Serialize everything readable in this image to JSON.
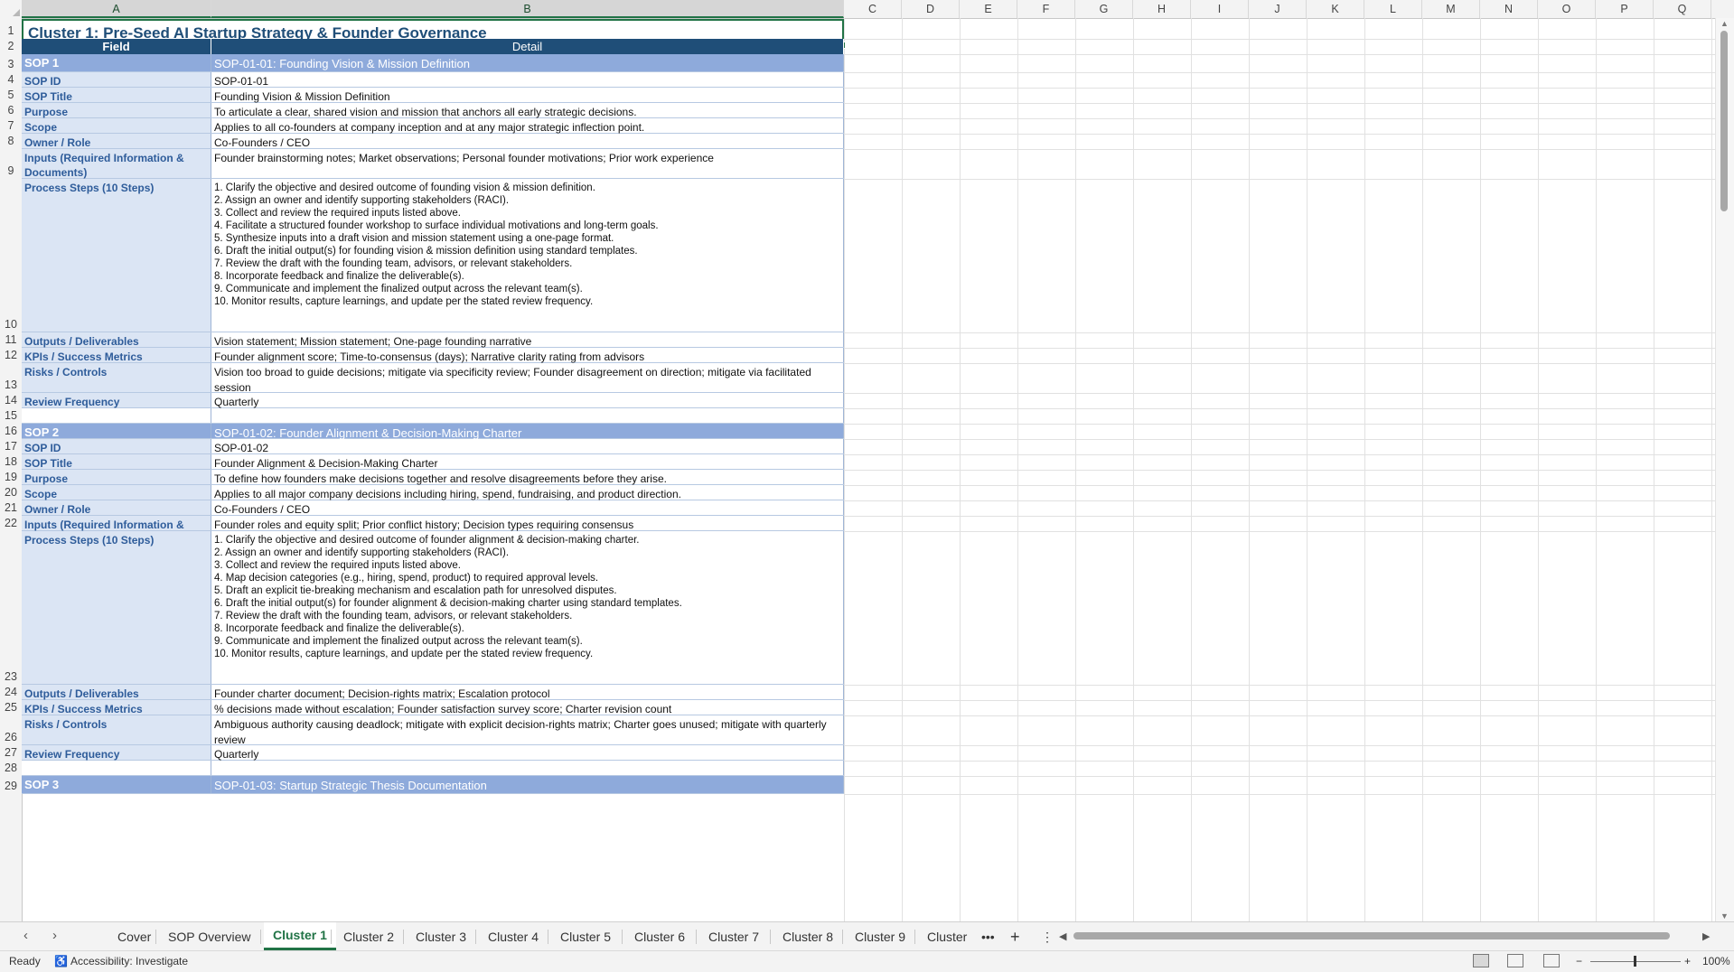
{
  "columns": [
    "A",
    "B",
    "C",
    "D",
    "E",
    "F",
    "G",
    "H",
    "I",
    "J",
    "K",
    "L",
    "M",
    "N",
    "O",
    "P",
    "Q"
  ],
  "title": "Cluster 1: Pre-Seed AI Startup Strategy & Founder Governance",
  "header": {
    "field": "Field",
    "detail": "Detail"
  },
  "rows": [
    {
      "num": "3",
      "a": "SOP 1",
      "b": "SOP-01-01: Founding Vision & Mission Definition"
    },
    {
      "num": "4",
      "a": "SOP ID",
      "b": "SOP-01-01"
    },
    {
      "num": "5",
      "a": "SOP Title",
      "b": "Founding Vision & Mission Definition"
    },
    {
      "num": "6",
      "a": "Purpose",
      "b": "To articulate a clear, shared vision and mission that anchors all early strategic decisions."
    },
    {
      "num": "7",
      "a": "Scope",
      "b": "Applies to all co-founders at company inception and at any major strategic inflection point."
    },
    {
      "num": "8",
      "a": "Owner / Role",
      "b": "Co-Founders / CEO"
    },
    {
      "num": "9",
      "a": "Inputs (Required Information & Documents)",
      "b": "Founder brainstorming notes; Market observations; Personal founder motivations; Prior work experience"
    },
    {
      "num": "10",
      "a": "Process Steps (10 Steps)",
      "b": "1. Clarify the objective and desired outcome of founding vision & mission definition.\n2. Assign an owner and identify supporting stakeholders (RACI).\n3. Collect and review the required inputs listed above.\n4. Facilitate a structured founder workshop to surface individual motivations and long-term goals.\n5. Synthesize inputs into a draft vision and mission statement using a one-page format.\n6. Draft the initial output(s) for founding vision & mission definition using standard templates.\n7. Review the draft with the founding team, advisors, or relevant stakeholders.\n8. Incorporate feedback and finalize the deliverable(s).\n9. Communicate and implement the finalized output across the relevant team(s).\n10. Monitor results, capture learnings, and update per the stated review frequency."
    },
    {
      "num": "11",
      "a": "Outputs / Deliverables",
      "b": "Vision statement; Mission statement; One-page founding narrative"
    },
    {
      "num": "12",
      "a": "KPIs / Success Metrics",
      "b": "Founder alignment score; Time-to-consensus (days); Narrative clarity rating from advisors"
    },
    {
      "num": "13",
      "a": "Risks / Controls",
      "b": "Vision too broad to guide decisions; mitigate via specificity review; Founder disagreement on direction; mitigate via facilitated session"
    },
    {
      "num": "14",
      "a": "Review Frequency",
      "b": "Quarterly"
    },
    {
      "num": "15",
      "a": "",
      "b": ""
    },
    {
      "num": "16",
      "a": "SOP 2",
      "b": "SOP-01-02: Founder Alignment & Decision-Making Charter"
    },
    {
      "num": "17",
      "a": "SOP ID",
      "b": "SOP-01-02"
    },
    {
      "num": "18",
      "a": "SOP Title",
      "b": "Founder Alignment & Decision-Making Charter"
    },
    {
      "num": "19",
      "a": "Purpose",
      "b": "To define how founders make decisions together and resolve disagreements before they arise."
    },
    {
      "num": "20",
      "a": "Scope",
      "b": "Applies to all major company decisions including hiring, spend, fundraising, and product direction."
    },
    {
      "num": "21",
      "a": "Owner / Role",
      "b": "Co-Founders / CEO"
    },
    {
      "num": "22",
      "a": "Inputs (Required Information &",
      "b": "Founder roles and equity split; Prior conflict history; Decision types requiring consensus"
    },
    {
      "num": "23",
      "a": "Process Steps (10 Steps)",
      "b": "1. Clarify the objective and desired outcome of founder alignment & decision-making charter.\n2. Assign an owner and identify supporting stakeholders (RACI).\n3. Collect and review the required inputs listed above.\n4. Map decision categories (e.g., hiring, spend, product) to required approval levels.\n5. Draft an explicit tie-breaking mechanism and escalation path for unresolved disputes.\n6. Draft the initial output(s) for founder alignment & decision-making charter using standard templates.\n7. Review the draft with the founding team, advisors, or relevant stakeholders.\n8. Incorporate feedback and finalize the deliverable(s).\n9. Communicate and implement the finalized output across the relevant team(s).\n10. Monitor results, capture learnings, and update per the stated review frequency."
    },
    {
      "num": "24",
      "a": "Outputs / Deliverables",
      "b": "Founder charter document; Decision-rights matrix; Escalation protocol"
    },
    {
      "num": "25",
      "a": "KPIs / Success Metrics",
      "b": "% decisions made without escalation; Founder satisfaction survey score; Charter revision count"
    },
    {
      "num": "26",
      "a": "Risks / Controls",
      "b": "Ambiguous authority causing deadlock; mitigate with explicit decision-rights matrix; Charter goes unused; mitigate with quarterly review"
    },
    {
      "num": "27",
      "a": "Review Frequency",
      "b": "Quarterly"
    },
    {
      "num": "28",
      "a": "",
      "b": ""
    },
    {
      "num": "29",
      "a": "SOP 3",
      "b": "SOP-01-03: Startup Strategic Thesis Documentation"
    }
  ],
  "tabs": [
    "Cover",
    "SOP Overview",
    "Cluster 1",
    "Cluster 2",
    "Cluster 3",
    "Cluster 4",
    "Cluster 5",
    "Cluster 6",
    "Cluster 7",
    "Cluster 8",
    "Cluster 9",
    "Cluster"
  ],
  "active_tab": "Cluster 1",
  "status": {
    "ready": "Ready",
    "accessibility": "Accessibility: Investigate",
    "zoom": "100%"
  },
  "colors": {
    "accent": "#217346",
    "header_fill": "#1f4e78",
    "sop_fill": "#8eaadb",
    "field_fill": "#dbe5f4"
  }
}
